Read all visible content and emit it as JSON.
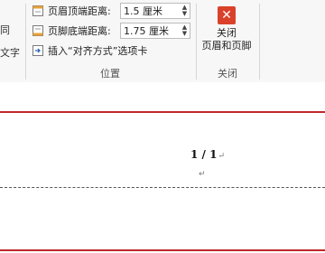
{
  "ribbon": {
    "left_partial": [
      "同",
      "文字"
    ],
    "position_group": {
      "header_label": "页眉顶端距离:",
      "header_value": "1.5 厘米",
      "footer_label": "页脚底端距离:",
      "footer_value": "1.75 厘米",
      "insert_tab": "插入“对齐方式”选项卡",
      "group_label": "位置"
    },
    "close_group": {
      "button_line1": "关闭",
      "button_line2": "页眉和页脚",
      "group_label": "关闭",
      "icon": "close-x-icon",
      "accent_color": "#d9412b"
    }
  },
  "document": {
    "page_number": "1 / 1",
    "paragraph_mark": "↵",
    "header_border_color": "#c0282a"
  }
}
